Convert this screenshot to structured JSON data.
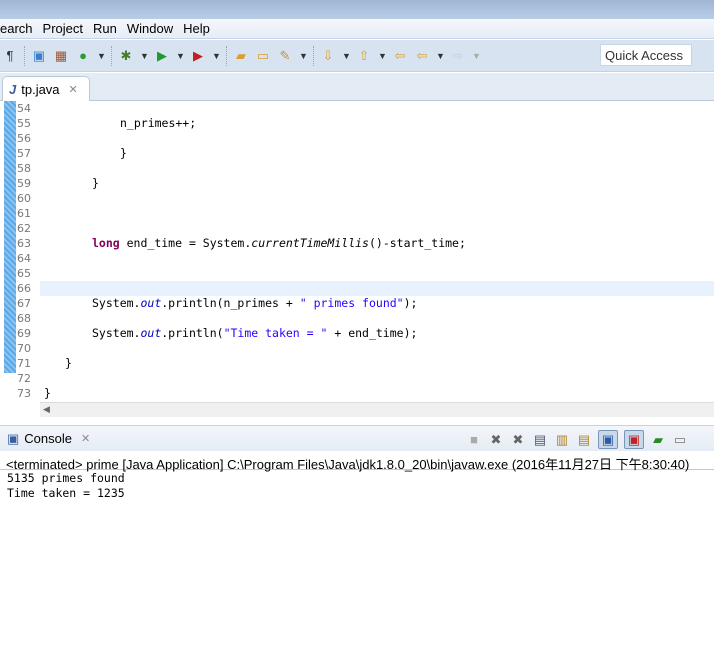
{
  "menu": [
    "earch",
    "Project",
    "Run",
    "Window",
    "Help"
  ],
  "quick_access": "Quick Access",
  "editor": {
    "tab_label": "tp.java",
    "line_numbers": [
      "54",
      "55",
      "56",
      "57",
      "58",
      "59",
      "60",
      "61",
      "62",
      "63",
      "64",
      "65",
      "66",
      "67",
      "68",
      "69",
      "70",
      "71",
      "72",
      "73"
    ],
    "code": {
      "l55": "n_primes++;",
      "l57": "}",
      "l59": "}",
      "l63_kw": "long",
      "l63_a": " end_time = System.",
      "l63_m": "currentTimeMillis",
      "l63_b": "()-start_time;",
      "l67_a": "System.",
      "l67_f": "out",
      "l67_b": ".println(n_primes + ",
      "l67_s": "\" primes found\"",
      "l67_c": ");",
      "l69_a": "System.",
      "l69_f": "out",
      "l69_b": ".println(",
      "l69_s": "\"Time taken = \"",
      "l69_c": " + end_time);",
      "l71": "}",
      "l73": "}"
    }
  },
  "console": {
    "tab_label": "Console",
    "info": "<terminated> prime [Java Application] C:\\Program Files\\Java\\jdk1.8.0_20\\bin\\javaw.exe (2016年11月27日 下午8:30:40)",
    "output": [
      "5135 primes found",
      "Time taken = 1235"
    ]
  }
}
